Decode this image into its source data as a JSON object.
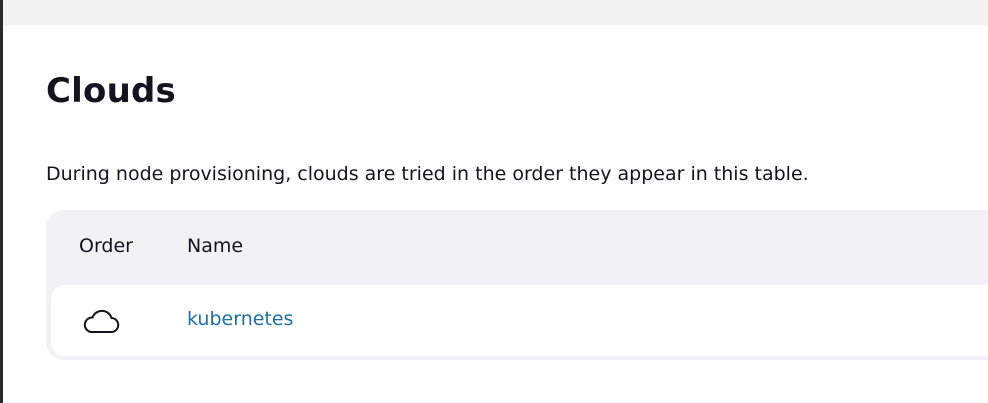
{
  "page": {
    "title": "Clouds",
    "description": "During node provisioning, clouds are tried in the order they appear in this table."
  },
  "table": {
    "columns": [
      "Order",
      "Name"
    ],
    "rows": [
      {
        "icon": "cloud-icon",
        "name": "kubernetes"
      }
    ]
  },
  "colors": {
    "link": "#1e6fa8",
    "card_background": "#f2f2f5",
    "text": "#14141f"
  }
}
